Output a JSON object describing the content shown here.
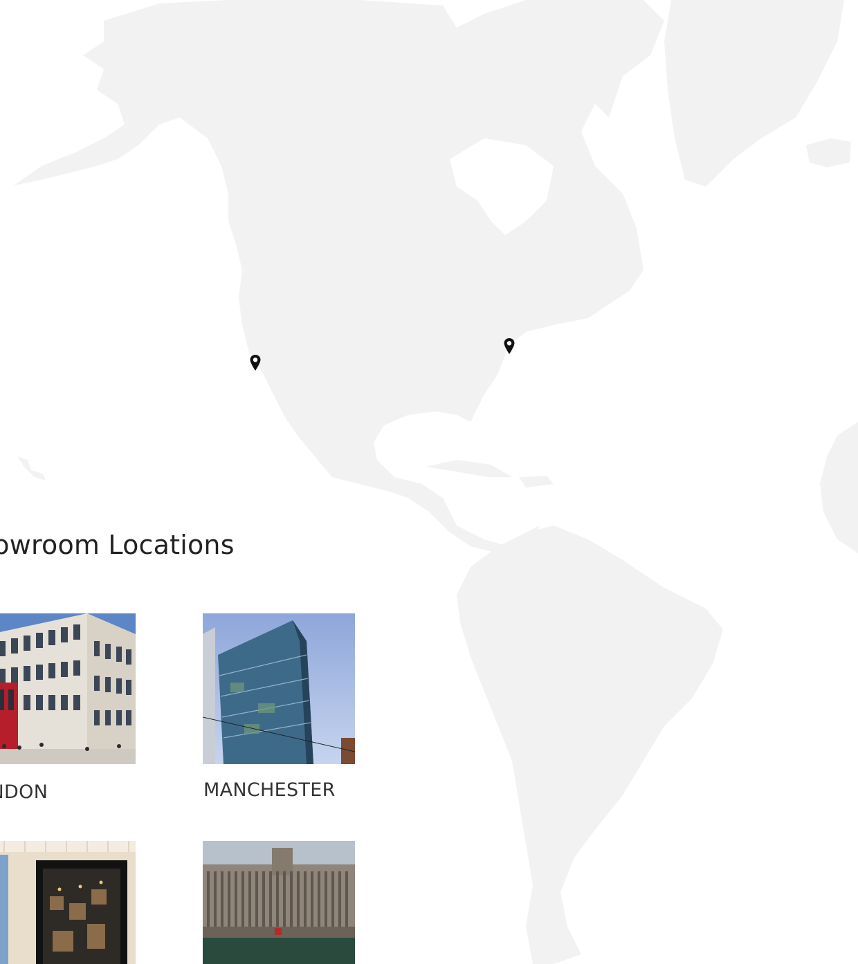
{
  "map": {
    "background": "#ffffff",
    "land_color": "#f2f2f2",
    "pin_color": "#111111",
    "pins": [
      {
        "name": "west-coast-pin",
        "icon": "map-pin-icon"
      },
      {
        "name": "east-coast-pin",
        "icon": "map-pin-icon"
      }
    ]
  },
  "showrooms": {
    "title": "howroom Locations",
    "locations": [
      {
        "city": "ONDON"
      },
      {
        "city": "MANCHESTER"
      },
      {
        "city": ""
      },
      {
        "city": ""
      }
    ]
  }
}
